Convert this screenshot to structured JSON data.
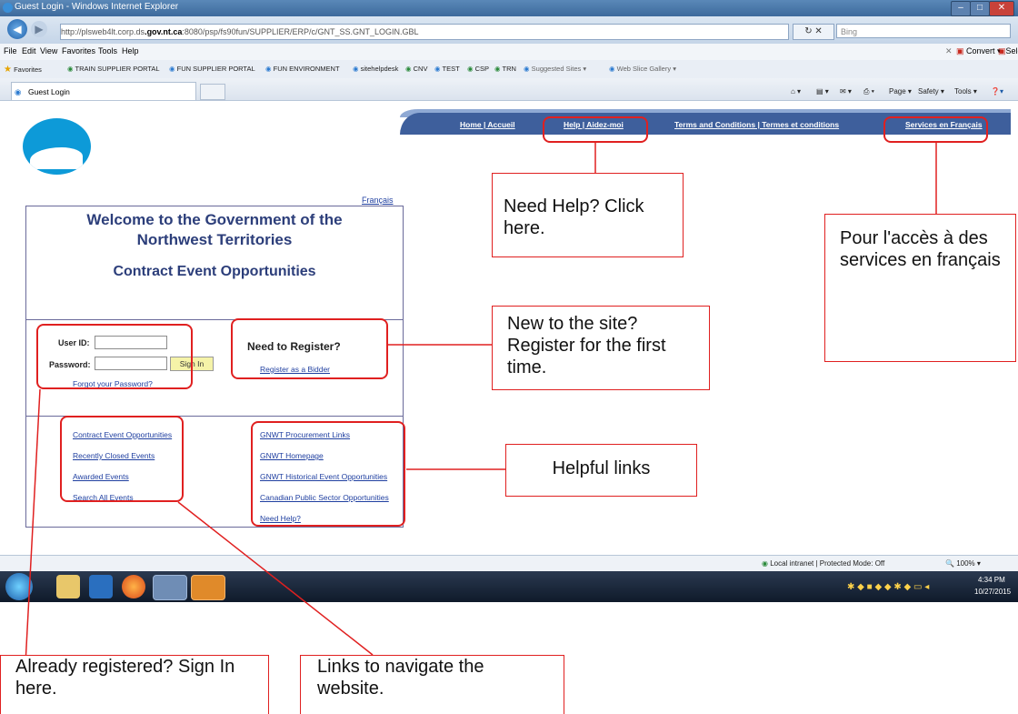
{
  "browser": {
    "title": "Guest Login - Windows Internet Explorer",
    "url_prefix": "http://",
    "url_host": "plsweb4lt.corp.ds",
    "url_domain": ".gov.nt.ca",
    "url_path": ":8080/psp/fs90fun/SUPPLIER/ERP/c/GNT_SS.GNT_LOGIN.GBL",
    "search_placeholder": "Bing",
    "menu": [
      "File",
      "Edit",
      "View",
      "Favorites",
      "Tools",
      "Help"
    ],
    "convert_label": "Convert",
    "select_label": "Select",
    "favorites_label": "Favorites",
    "favorites": [
      "TRAIN SUPPLIER PORTAL",
      "FUN SUPPLIER PORTAL",
      "FUN ENVIRONMENT",
      "sitehelpdesk",
      "CNV",
      "TEST",
      "CSP",
      "TRN",
      "Suggested Sites ▾",
      "Web Slice Gallery ▾"
    ],
    "tab_title": "Guest Login",
    "toolbar": [
      "Page ▾",
      "Safety ▾",
      "Tools ▾"
    ],
    "status_zone": "Local intranet | Protected Mode: Off",
    "zoom": "100%",
    "clock_time": "4:34 PM",
    "clock_date": "10/27/2015"
  },
  "page": {
    "nav_links": [
      "Home | Accueil",
      "Help | Aidez-moi",
      "Terms and Conditions | Termes et conditions",
      "Services en Français"
    ],
    "francais_link": "Français",
    "welcome_line1": "Welcome to the Government of the",
    "welcome_line2": "Northwest Territories",
    "subtitle": "Contract Event Opportunities",
    "userid_label": "User ID:",
    "password_label": "Password:",
    "signin_label": "Sign In",
    "forgot_link": "Forgot your Password?",
    "register_heading": "Need to Register?",
    "register_link": "Register as a Bidder",
    "left_links": [
      "Contract Event Opportunities",
      "Recently Closed Events",
      "Awarded Events",
      "Search All Events"
    ],
    "right_links": [
      "GNWT Procurement Links",
      "GNWT Homepage",
      "GNWT Historical Event Opportunities",
      "Canadian Public Sector Opportunities",
      "Need Help?"
    ]
  },
  "callouts": {
    "help": "Need Help? Click here.",
    "francais": "Pour l'accès à des services en français",
    "register": "New to the site? Register for the first time.",
    "links": "Helpful links",
    "signin": "Already registered? Sign In here.",
    "navigate": "Links to navigate the website."
  },
  "colors": {
    "nav_band": "#3e5f9c",
    "annotation": "#e02020",
    "heading": "#2c3e7a",
    "link": "#1f3fa0"
  }
}
